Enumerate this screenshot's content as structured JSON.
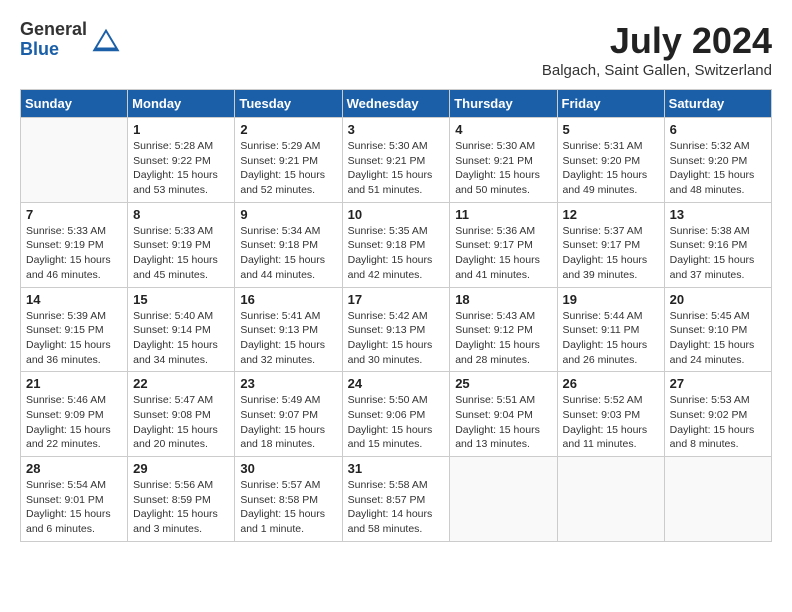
{
  "header": {
    "logo_general": "General",
    "logo_blue": "Blue",
    "title": "July 2024",
    "location": "Balgach, Saint Gallen, Switzerland"
  },
  "weekdays": [
    "Sunday",
    "Monday",
    "Tuesday",
    "Wednesday",
    "Thursday",
    "Friday",
    "Saturday"
  ],
  "weeks": [
    [
      {
        "day": "",
        "info": ""
      },
      {
        "day": "1",
        "info": "Sunrise: 5:28 AM\nSunset: 9:22 PM\nDaylight: 15 hours\nand 53 minutes."
      },
      {
        "day": "2",
        "info": "Sunrise: 5:29 AM\nSunset: 9:21 PM\nDaylight: 15 hours\nand 52 minutes."
      },
      {
        "day": "3",
        "info": "Sunrise: 5:30 AM\nSunset: 9:21 PM\nDaylight: 15 hours\nand 51 minutes."
      },
      {
        "day": "4",
        "info": "Sunrise: 5:30 AM\nSunset: 9:21 PM\nDaylight: 15 hours\nand 50 minutes."
      },
      {
        "day": "5",
        "info": "Sunrise: 5:31 AM\nSunset: 9:20 PM\nDaylight: 15 hours\nand 49 minutes."
      },
      {
        "day": "6",
        "info": "Sunrise: 5:32 AM\nSunset: 9:20 PM\nDaylight: 15 hours\nand 48 minutes."
      }
    ],
    [
      {
        "day": "7",
        "info": "Sunrise: 5:33 AM\nSunset: 9:19 PM\nDaylight: 15 hours\nand 46 minutes."
      },
      {
        "day": "8",
        "info": "Sunrise: 5:33 AM\nSunset: 9:19 PM\nDaylight: 15 hours\nand 45 minutes."
      },
      {
        "day": "9",
        "info": "Sunrise: 5:34 AM\nSunset: 9:18 PM\nDaylight: 15 hours\nand 44 minutes."
      },
      {
        "day": "10",
        "info": "Sunrise: 5:35 AM\nSunset: 9:18 PM\nDaylight: 15 hours\nand 42 minutes."
      },
      {
        "day": "11",
        "info": "Sunrise: 5:36 AM\nSunset: 9:17 PM\nDaylight: 15 hours\nand 41 minutes."
      },
      {
        "day": "12",
        "info": "Sunrise: 5:37 AM\nSunset: 9:17 PM\nDaylight: 15 hours\nand 39 minutes."
      },
      {
        "day": "13",
        "info": "Sunrise: 5:38 AM\nSunset: 9:16 PM\nDaylight: 15 hours\nand 37 minutes."
      }
    ],
    [
      {
        "day": "14",
        "info": "Sunrise: 5:39 AM\nSunset: 9:15 PM\nDaylight: 15 hours\nand 36 minutes."
      },
      {
        "day": "15",
        "info": "Sunrise: 5:40 AM\nSunset: 9:14 PM\nDaylight: 15 hours\nand 34 minutes."
      },
      {
        "day": "16",
        "info": "Sunrise: 5:41 AM\nSunset: 9:13 PM\nDaylight: 15 hours\nand 32 minutes."
      },
      {
        "day": "17",
        "info": "Sunrise: 5:42 AM\nSunset: 9:13 PM\nDaylight: 15 hours\nand 30 minutes."
      },
      {
        "day": "18",
        "info": "Sunrise: 5:43 AM\nSunset: 9:12 PM\nDaylight: 15 hours\nand 28 minutes."
      },
      {
        "day": "19",
        "info": "Sunrise: 5:44 AM\nSunset: 9:11 PM\nDaylight: 15 hours\nand 26 minutes."
      },
      {
        "day": "20",
        "info": "Sunrise: 5:45 AM\nSunset: 9:10 PM\nDaylight: 15 hours\nand 24 minutes."
      }
    ],
    [
      {
        "day": "21",
        "info": "Sunrise: 5:46 AM\nSunset: 9:09 PM\nDaylight: 15 hours\nand 22 minutes."
      },
      {
        "day": "22",
        "info": "Sunrise: 5:47 AM\nSunset: 9:08 PM\nDaylight: 15 hours\nand 20 minutes."
      },
      {
        "day": "23",
        "info": "Sunrise: 5:49 AM\nSunset: 9:07 PM\nDaylight: 15 hours\nand 18 minutes."
      },
      {
        "day": "24",
        "info": "Sunrise: 5:50 AM\nSunset: 9:06 PM\nDaylight: 15 hours\nand 15 minutes."
      },
      {
        "day": "25",
        "info": "Sunrise: 5:51 AM\nSunset: 9:04 PM\nDaylight: 15 hours\nand 13 minutes."
      },
      {
        "day": "26",
        "info": "Sunrise: 5:52 AM\nSunset: 9:03 PM\nDaylight: 15 hours\nand 11 minutes."
      },
      {
        "day": "27",
        "info": "Sunrise: 5:53 AM\nSunset: 9:02 PM\nDaylight: 15 hours\nand 8 minutes."
      }
    ],
    [
      {
        "day": "28",
        "info": "Sunrise: 5:54 AM\nSunset: 9:01 PM\nDaylight: 15 hours\nand 6 minutes."
      },
      {
        "day": "29",
        "info": "Sunrise: 5:56 AM\nSunset: 8:59 PM\nDaylight: 15 hours\nand 3 minutes."
      },
      {
        "day": "30",
        "info": "Sunrise: 5:57 AM\nSunset: 8:58 PM\nDaylight: 15 hours\nand 1 minute."
      },
      {
        "day": "31",
        "info": "Sunrise: 5:58 AM\nSunset: 8:57 PM\nDaylight: 14 hours\nand 58 minutes."
      },
      {
        "day": "",
        "info": ""
      },
      {
        "day": "",
        "info": ""
      },
      {
        "day": "",
        "info": ""
      }
    ]
  ]
}
